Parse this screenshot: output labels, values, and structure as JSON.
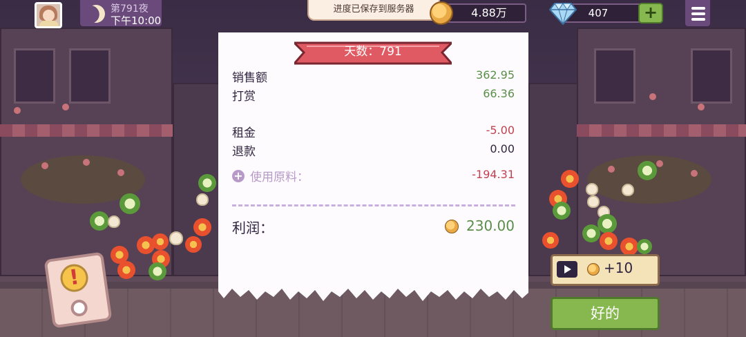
{
  "header": {
    "day_title": "第791夜",
    "time": "下午10:00",
    "toast": "进度已保存到服务器",
    "coins": "4.88万",
    "gems": "407",
    "gem_plus": "+"
  },
  "receipt": {
    "ribbon": "天数：791",
    "rows": [
      {
        "label": "销售额",
        "value": "362.95"
      },
      {
        "label": "打赏",
        "value": "66.36"
      },
      {
        "label": "租金",
        "value": "-5.00"
      },
      {
        "label": "退款",
        "value": "0.00"
      },
      {
        "label": "使用原料：",
        "value": "-194.31"
      }
    ],
    "profit_label": "利润：",
    "profit_value": "230.00"
  },
  "actions": {
    "ad_reward": "+10",
    "ok": "好的"
  },
  "icons": {
    "avatar": "avatar",
    "moon": "moon-icon",
    "coin": "coin-icon",
    "gem": "diamond-icon",
    "menu": "hamburger-menu-icon",
    "play": "video-play-icon",
    "phone": "phone-alert-icon",
    "expand": "plus-circle-icon"
  },
  "colors": {
    "positive": "#5b8d4a",
    "negative": "#c2404f",
    "ribbon": "#e05a63",
    "ok_button": "#86b84f"
  }
}
